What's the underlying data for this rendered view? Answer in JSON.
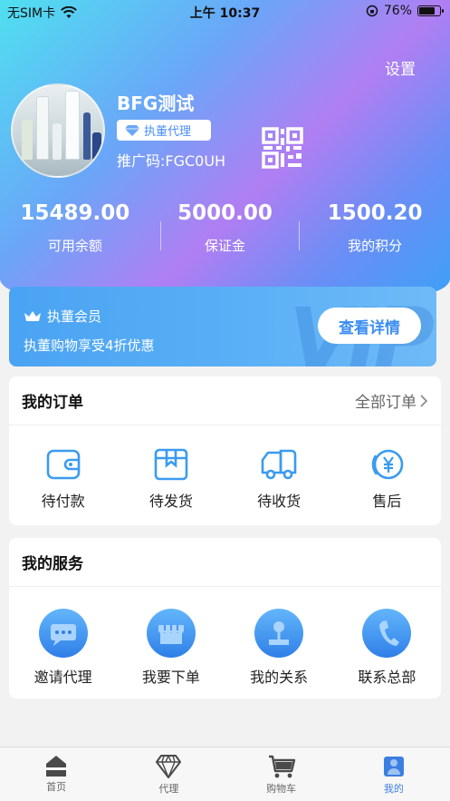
{
  "status_bar": {
    "carrier": "无SIM卡",
    "time": "上午 10:37",
    "battery": "76%",
    "battery_level": 0.76
  },
  "header": {
    "settings_label": "设置",
    "user_name": "BFG测试",
    "badge_label": "执董代理",
    "promo_code": "推广码:FGC0UH",
    "qr_icon": "qr-code-icon"
  },
  "stats": [
    {
      "value": "15489.00",
      "label": "可用余额"
    },
    {
      "value": "5000.00",
      "label": "保证金"
    },
    {
      "value": "1500.20",
      "label": "我的积分"
    }
  ],
  "vip": {
    "title": "执董会员",
    "description": "执董购物享受4折优惠",
    "button_label": "查看详情",
    "watermark": "VIP"
  },
  "orders": {
    "title": "我的订单",
    "all_label": "全部订单",
    "items": [
      {
        "label": "待付款",
        "icon": "wallet-icon"
      },
      {
        "label": "待发货",
        "icon": "package-icon"
      },
      {
        "label": "待收货",
        "icon": "truck-icon"
      },
      {
        "label": "售后",
        "icon": "yen-refund-icon"
      }
    ]
  },
  "services": {
    "title": "我的服务",
    "items": [
      {
        "label": "邀请代理",
        "icon": "chat-icon"
      },
      {
        "label": "我要下单",
        "icon": "store-icon"
      },
      {
        "label": "我的关系",
        "icon": "relation-icon"
      },
      {
        "label": "联系总部",
        "icon": "phone-icon"
      }
    ]
  },
  "nav": {
    "items": [
      {
        "label": "首页",
        "icon": "home-icon"
      },
      {
        "label": "代理",
        "icon": "diamond-icon"
      },
      {
        "label": "购物车",
        "icon": "cart-icon"
      },
      {
        "label": "我的",
        "icon": "user-icon"
      }
    ],
    "active": "我的"
  },
  "colors": {
    "accent": "#3b8ef3",
    "nav_active": "#3b7fe0"
  }
}
